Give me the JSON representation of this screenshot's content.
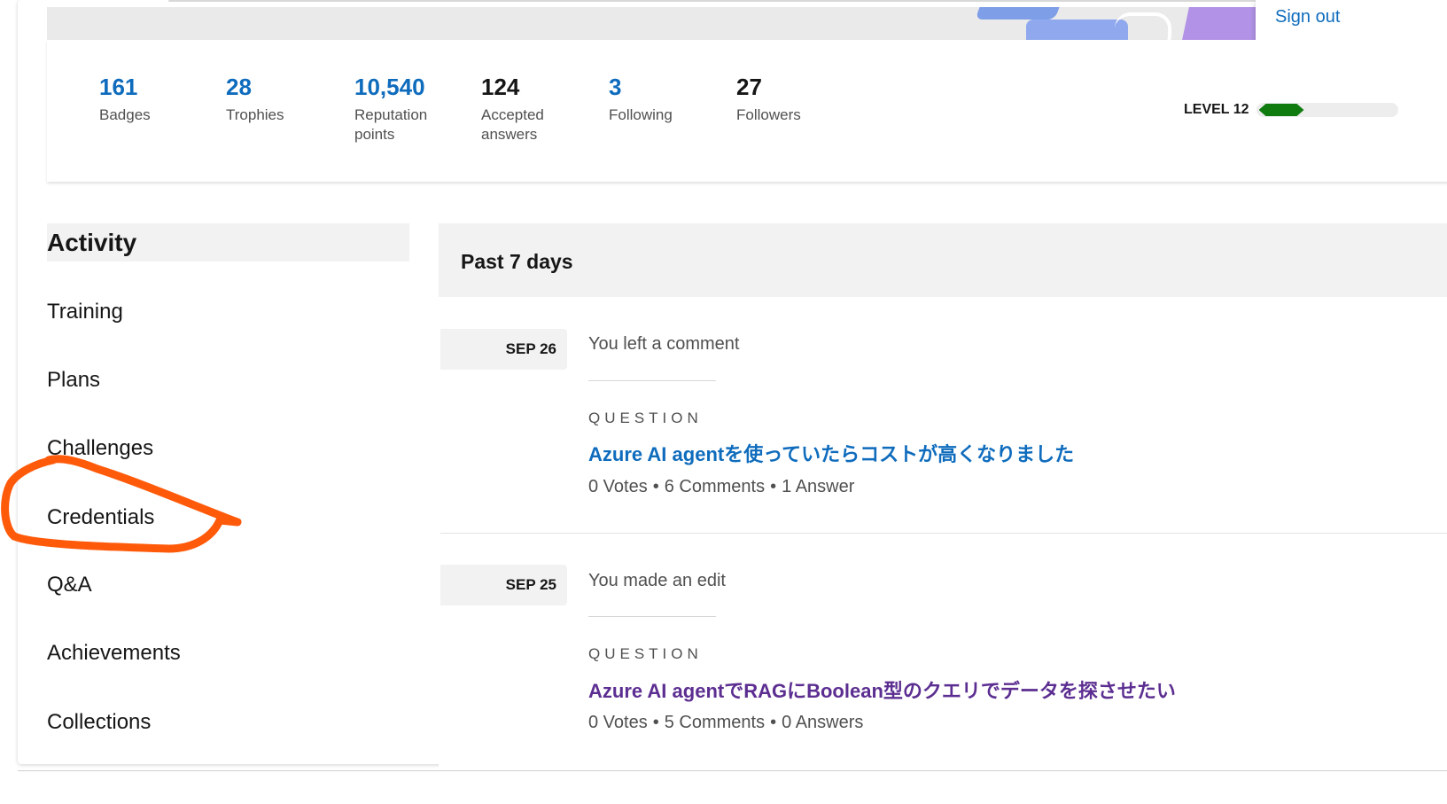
{
  "header": {
    "sign_out_label": "Sign out"
  },
  "stats": [
    {
      "value": "161",
      "label": "Badges",
      "link": true
    },
    {
      "value": "28",
      "label": "Trophies",
      "link": true
    },
    {
      "value": "10,540",
      "label": "Reputation points",
      "link": true
    },
    {
      "value": "124",
      "label": "Accepted answers",
      "link": false
    },
    {
      "value": "3",
      "label": "Following",
      "link": true
    },
    {
      "value": "27",
      "label": "Followers",
      "link": false
    }
  ],
  "level": {
    "label": "LEVEL 12",
    "progress_fraction": 0.33,
    "color": "#107c10"
  },
  "nav": {
    "items": [
      {
        "label": "Activity",
        "active": true
      },
      {
        "label": "Training",
        "active": false
      },
      {
        "label": "Plans",
        "active": false
      },
      {
        "label": "Challenges",
        "active": false
      },
      {
        "label": "Credentials",
        "active": false
      },
      {
        "label": "Q&A",
        "active": false
      },
      {
        "label": "Achievements",
        "active": false
      },
      {
        "label": "Collections",
        "active": false
      }
    ]
  },
  "activity": {
    "header": "Past 7 days",
    "entries": [
      {
        "date": "SEP 26",
        "action": "You left a comment",
        "kind": "QUESTION",
        "title": "Azure AI agentを使っていたらコストが高くなりました",
        "votes": "0 Votes",
        "comments": "6 Comments",
        "answers": "1 Answer"
      },
      {
        "date": "SEP 25",
        "action": "You made an edit",
        "kind": "QUESTION",
        "title": "Azure AI agentでRAGにBoolean型のクエリでデータを探させたい",
        "votes": "0 Votes",
        "comments": "5 Comments",
        "answers": "0 Answers"
      }
    ]
  },
  "colors": {
    "link": "#0f6cbd",
    "visited_link": "#5c2e91",
    "annotation": "#ff5a0a"
  }
}
